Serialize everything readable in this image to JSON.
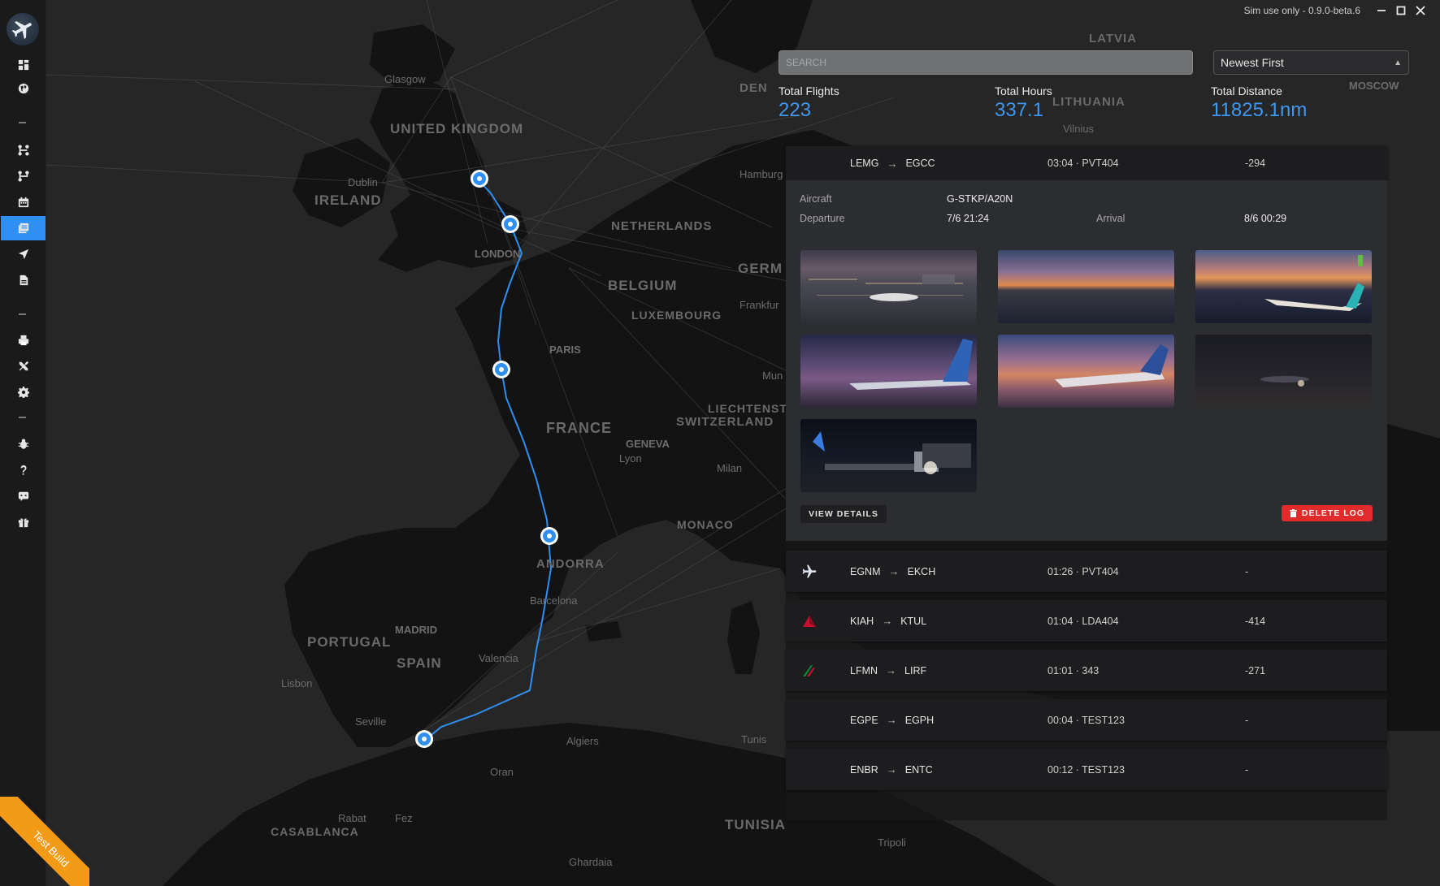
{
  "app": {
    "version": "Sim use only - 0.9.0-beta.6"
  },
  "search": {
    "placeholder": "SEARCH"
  },
  "sort": {
    "selected": "Newest First"
  },
  "stats": {
    "total_flights_label": "Total Flights",
    "total_flights": "223",
    "total_hours_label": "Total Hours",
    "total_hours": "337.1",
    "total_distance_label": "Total Distance",
    "total_distance": "11825.1nm"
  },
  "sidebar": {
    "items": [
      {
        "icon": "dashboard-icon"
      },
      {
        "icon": "globe-icon"
      },
      {
        "icon": "route-icon"
      },
      {
        "icon": "route-alt-icon"
      },
      {
        "icon": "calendar-icon"
      },
      {
        "icon": "logbook-icon",
        "active": true
      },
      {
        "icon": "plane-icon"
      },
      {
        "icon": "document-icon"
      },
      {
        "icon": "printer-icon"
      },
      {
        "icon": "tools-icon"
      },
      {
        "icon": "gear-icon"
      },
      {
        "icon": "bug-icon"
      },
      {
        "icon": "help-icon"
      },
      {
        "icon": "chat-icon"
      },
      {
        "icon": "gift-icon"
      }
    ]
  },
  "map": {
    "labels": {
      "uk": "UNITED KINGDOM",
      "ireland": "IRELAND",
      "netherlands": "NETHERLANDS",
      "belgium": "BELGIUM",
      "luxembourg": "LUXEMBOURG",
      "germany": "GERM",
      "france": "FRANCE",
      "switzerland": "SWITZERLAND",
      "liechtenstein": "LIECHTENST",
      "monaco": "MONACO",
      "andorra": "ANDORRA",
      "portugal": "PORTUGAL",
      "spain": "SPAIN",
      "casablanca": "CASABLANCA",
      "tunisia": "TUNISIA",
      "denmark": "DEN",
      "latvia": "LATVIA",
      "lithuania": "LITHUANIA"
    },
    "cities": {
      "glasgow": "Glasgow",
      "dublin": "Dublin",
      "london": "LONDON",
      "paris": "PARIS",
      "hamburg": "Hamburg",
      "frankfurt": "Frankfur",
      "geneva": "GENEVA",
      "lyon": "Lyon",
      "milan": "Milan",
      "barcelona": "Barcelona",
      "madrid": "MADRID",
      "valencia": "Valencia",
      "lisbon": "Lisbon",
      "seville": "Seville",
      "algiers": "Algiers",
      "oran": "Oran",
      "rabat": "Rabat",
      "fez": "Fez",
      "ghardaia": "Ghardaia",
      "tunis": "Tunis",
      "tripoli": "Tripoli",
      "vilnius": "Vilnius",
      "moscow": "MOSCOW",
      "mun": "Mun"
    }
  },
  "flights": [
    {
      "from": "LEMG",
      "to": "EGCC",
      "time": "03:04 · PVT404",
      "score": "-294",
      "expanded": true,
      "aircraft_label": "Aircraft",
      "aircraft": "G-STKP/A20N",
      "departure_label": "Departure",
      "departure": "7/6 21:24",
      "arrival_label": "Arrival",
      "arrival": "8/6 00:29",
      "view_details": "VIEW DETAILS",
      "delete_log": "DELETE LOG"
    },
    {
      "from": "EGNM",
      "to": "EKCH",
      "time": "01:26 · PVT404",
      "score": "-",
      "airline_icon": "plane-icon"
    },
    {
      "from": "KIAH",
      "to": "KTUL",
      "time": "01:04 · LDA404",
      "score": "-414",
      "airline_icon": "delta-icon"
    },
    {
      "from": "LFMN",
      "to": "LIRF",
      "time": "01:01 · 343",
      "score": "-271",
      "airline_icon": "alitalia-icon"
    },
    {
      "from": "EGPE",
      "to": "EGPH",
      "time": "00:04 · TEST123",
      "score": "-"
    },
    {
      "from": "ENBR",
      "to": "ENTC",
      "time": "00:12 · TEST123",
      "score": "-"
    }
  ],
  "ribbon": "Test Build",
  "colors": {
    "accent": "#2f8ff2",
    "delete": "#e22b2b",
    "ribbon": "#f39a16"
  }
}
